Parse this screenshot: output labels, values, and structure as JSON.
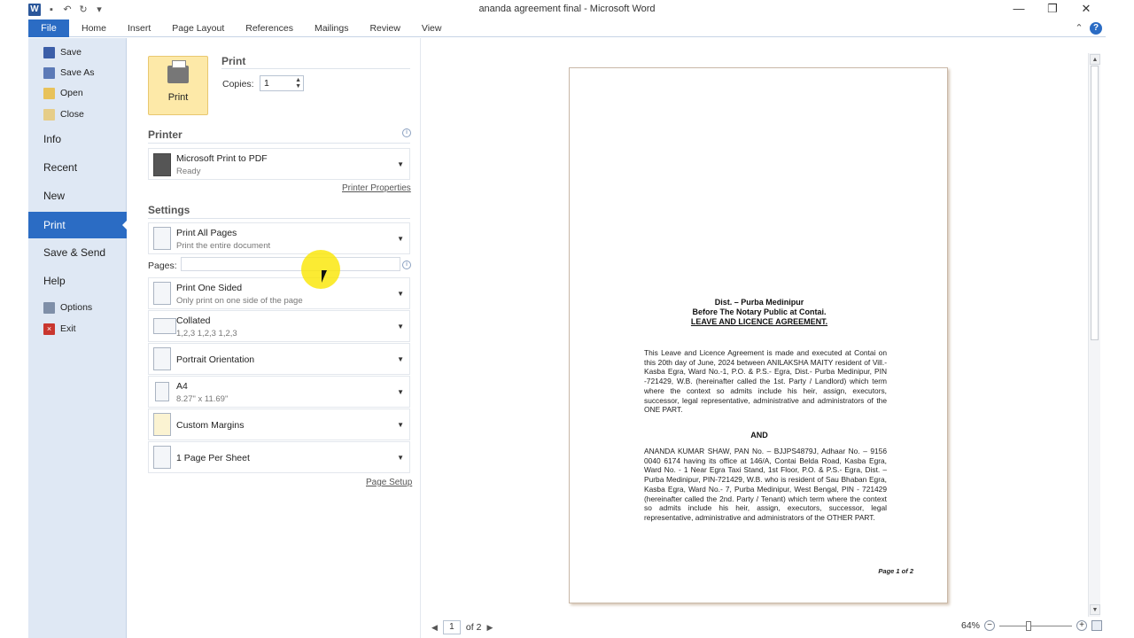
{
  "window": {
    "title": "ananda agreement final  -  Microsoft Word",
    "word_icon": "W",
    "controls": {
      "minimize": "—",
      "restore": "❐",
      "close": "✕"
    }
  },
  "ribbon": {
    "file_tab": "File",
    "tabs": [
      "Home",
      "Insert",
      "Page Layout",
      "References",
      "Mailings",
      "Review",
      "View"
    ],
    "help": "?"
  },
  "nav": {
    "save": "Save",
    "save_as": "Save As",
    "open": "Open",
    "close": "Close",
    "info": "Info",
    "recent": "Recent",
    "new": "New",
    "print": "Print",
    "save_send": "Save & Send",
    "help": "Help",
    "options": "Options",
    "exit": "Exit"
  },
  "print": {
    "button_label": "Print",
    "section_title": "Print",
    "copies_label": "Copies:",
    "copies_value": "1",
    "printer_title": "Printer",
    "printer_name": "Microsoft Print to PDF",
    "printer_status": "Ready",
    "printer_properties": "Printer Properties",
    "settings_title": "Settings",
    "pages_label": "Pages:",
    "pages_value": "",
    "settings": {
      "range_main": "Print All Pages",
      "range_sub": "Print the entire document",
      "sides_main": "Print One Sided",
      "sides_sub": "Only print on one side of the page",
      "collate_main": "Collated",
      "collate_sub": "1,2,3    1,2,3    1,2,3",
      "orientation_main": "Portrait Orientation",
      "paper_main": "A4",
      "paper_sub": "8.27\" x 11.69\"",
      "margins_main": "Custom Margins",
      "sheet_main": "1 Page Per Sheet"
    },
    "page_setup": "Page Setup"
  },
  "preview": {
    "heading1": "Dist. – Purba Medinipur",
    "heading2": "Before The Notary Public at Contai.",
    "heading3": "LEAVE AND LICENCE AGREEMENT.",
    "para1": "This Leave and Licence Agreement is made and executed at Contai on this 20th day of June, 2024 between ANILAKSHA MAITY resident of Vill.- Kasba Egra, Ward No.-1, P.O. & P.S.- Egra, Dist.- Purba Medinipur, PIN -721429, W.B. (hereinafter called the 1st. Party / Landlord) which term where the context so admits include his heir, assign, executors, successor, legal representative, administrative and administrators of the ONE PART.",
    "and": "AND",
    "para2": "ANANDA KUMAR SHAW, PAN No. – BJJPS4879J, Adhaar No. – 9156 0040 6174 having its office at 146/A, Contai Belda Road, Kasba Egra, Ward No. - 1 Near Egra Taxi Stand, 1st Floor, P.O. & P.S.- Egra, Dist. – Purba Medinipur, PIN-721429, W.B. who is resident of Sau Bhaban Egra, Kasba Egra, Ward No.- 7, Purba Medinipur, West Bengal, PIN - 721429 (hereinafter called the 2nd. Party / Tenant) which term where the context so admits include his heir, assign, executors, successor, legal representative, administrative and administrators of the OTHER PART.",
    "footer": "Page 1 of 2",
    "current_page": "1",
    "of_pages": "of 2",
    "zoom": "64%"
  }
}
